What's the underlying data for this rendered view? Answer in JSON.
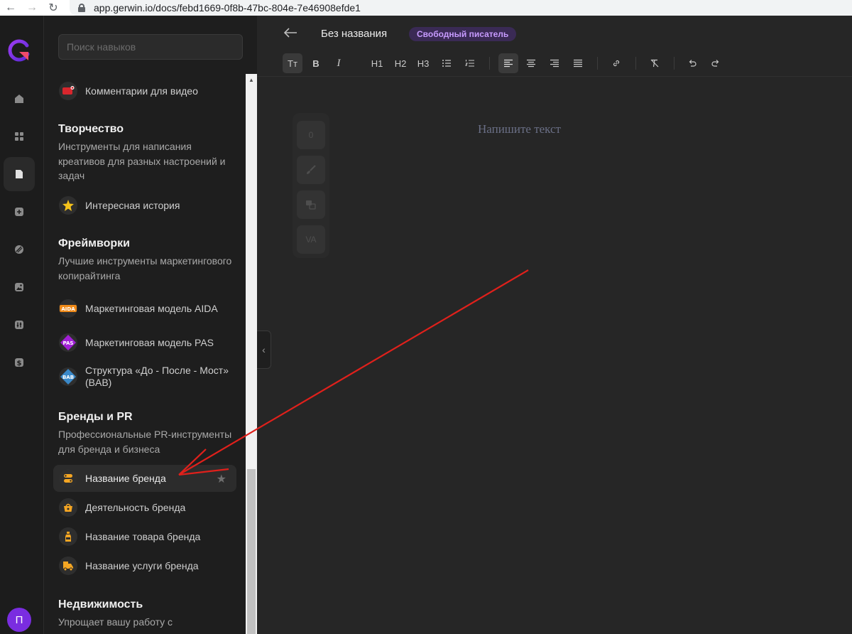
{
  "browser": {
    "url": "app.gerwin.io/docs/febd1669-0f8b-47bc-804e-7e46908efde1"
  },
  "rail": {
    "avatar_letter": "П"
  },
  "skills": {
    "search_placeholder": "Поиск навыков",
    "top_item": "Комментарии для видео",
    "creativity": {
      "title": "Творчество",
      "desc": "Инструменты для написания креативов для разных настроений и задач",
      "items": [
        "Интересная история"
      ]
    },
    "frameworks": {
      "title": "Фреймворки",
      "desc": "Лучшие инструменты маркетингового копирайтинга",
      "items": [
        "Маркетинговая модель AIDA",
        "Маркетинговая модель PAS",
        "Структура «До - После - Мост» (BAB)"
      ],
      "badges": [
        "AIDA",
        "PAS",
        "BAB"
      ]
    },
    "brands": {
      "title": "Бренды и PR",
      "desc": "Профессиональные PR-инструменты для бренда и бизнеса",
      "items": [
        "Название бренда",
        "Деятельность бренда",
        "Название товара бренда",
        "Название услуги бренда"
      ]
    },
    "realty": {
      "title": "Недвижимость",
      "desc": "Упрощает вашу работу с"
    }
  },
  "editor": {
    "title": "Без названия",
    "mode_badge": "Свободный писатель",
    "placeholder": "Напишите текст",
    "toolbar": {
      "text_style": "Tт",
      "bold": "B",
      "italic": "I",
      "h1": "H1",
      "h2": "H2",
      "h3": "H3"
    },
    "side_tools": {
      "counter": "0",
      "va": "VA"
    }
  },
  "colors": {
    "accent_purple": "#7a2de0",
    "badge_text": "#c79bff",
    "arrow_red": "#e0201b",
    "brand_orange": "#f5a623"
  }
}
